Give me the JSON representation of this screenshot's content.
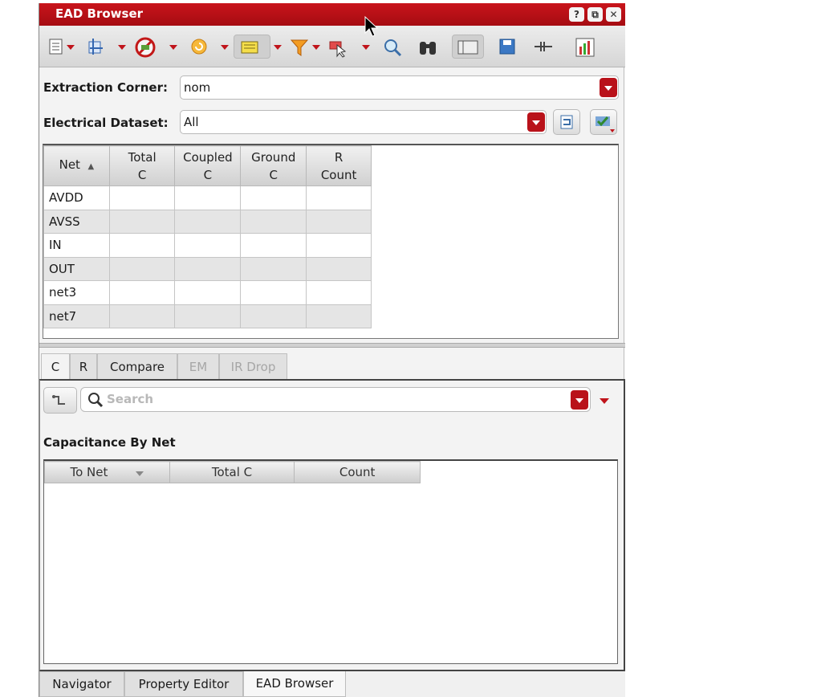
{
  "window": {
    "title": "EAD Browser",
    "help": "?",
    "restore": "⧉",
    "close": "✕"
  },
  "toolbar": {
    "icons": [
      "layout-view-icon",
      "probe-net-icon",
      "no-highlight-icon",
      "refresh-icon",
      "annotation-icon",
      "filter-icon",
      "select-pointer-icon",
      "zoom-in-icon",
      "binoculars-icon",
      "panel-view-icon",
      "save-icon",
      "circuit-icon",
      "chart-icon"
    ]
  },
  "extraction": {
    "label": "Extraction Corner:",
    "value": "nom"
  },
  "dataset": {
    "label": "Electrical Dataset:",
    "value": "All"
  },
  "net_table": {
    "headers": [
      {
        "l1": "Net",
        "l2": "",
        "sort": "▲"
      },
      {
        "l1": "Total",
        "l2": "C"
      },
      {
        "l1": "Coupled",
        "l2": "C"
      },
      {
        "l1": "Ground",
        "l2": "C"
      },
      {
        "l1": "R",
        "l2": "Count"
      }
    ],
    "rows": [
      "AVDD",
      "AVSS",
      "IN",
      "OUT",
      "net3",
      "net7"
    ]
  },
  "tabs": [
    {
      "label": "C",
      "state": "active"
    },
    {
      "label": "R",
      "state": "normal"
    },
    {
      "label": "Compare",
      "state": "normal"
    },
    {
      "label": "EM",
      "state": "disabled"
    },
    {
      "label": "IR Drop",
      "state": "disabled"
    }
  ],
  "search": {
    "placeholder": "Search"
  },
  "section_title": "Capacitance By Net",
  "cap_table": {
    "headers": [
      "To Net",
      "Total C",
      "Count"
    ]
  },
  "bottom_tabs": [
    "Navigator",
    "Property Editor",
    "EAD Browser"
  ],
  "colors": {
    "accent": "#b9121a",
    "panel": "#f3f3f3"
  }
}
